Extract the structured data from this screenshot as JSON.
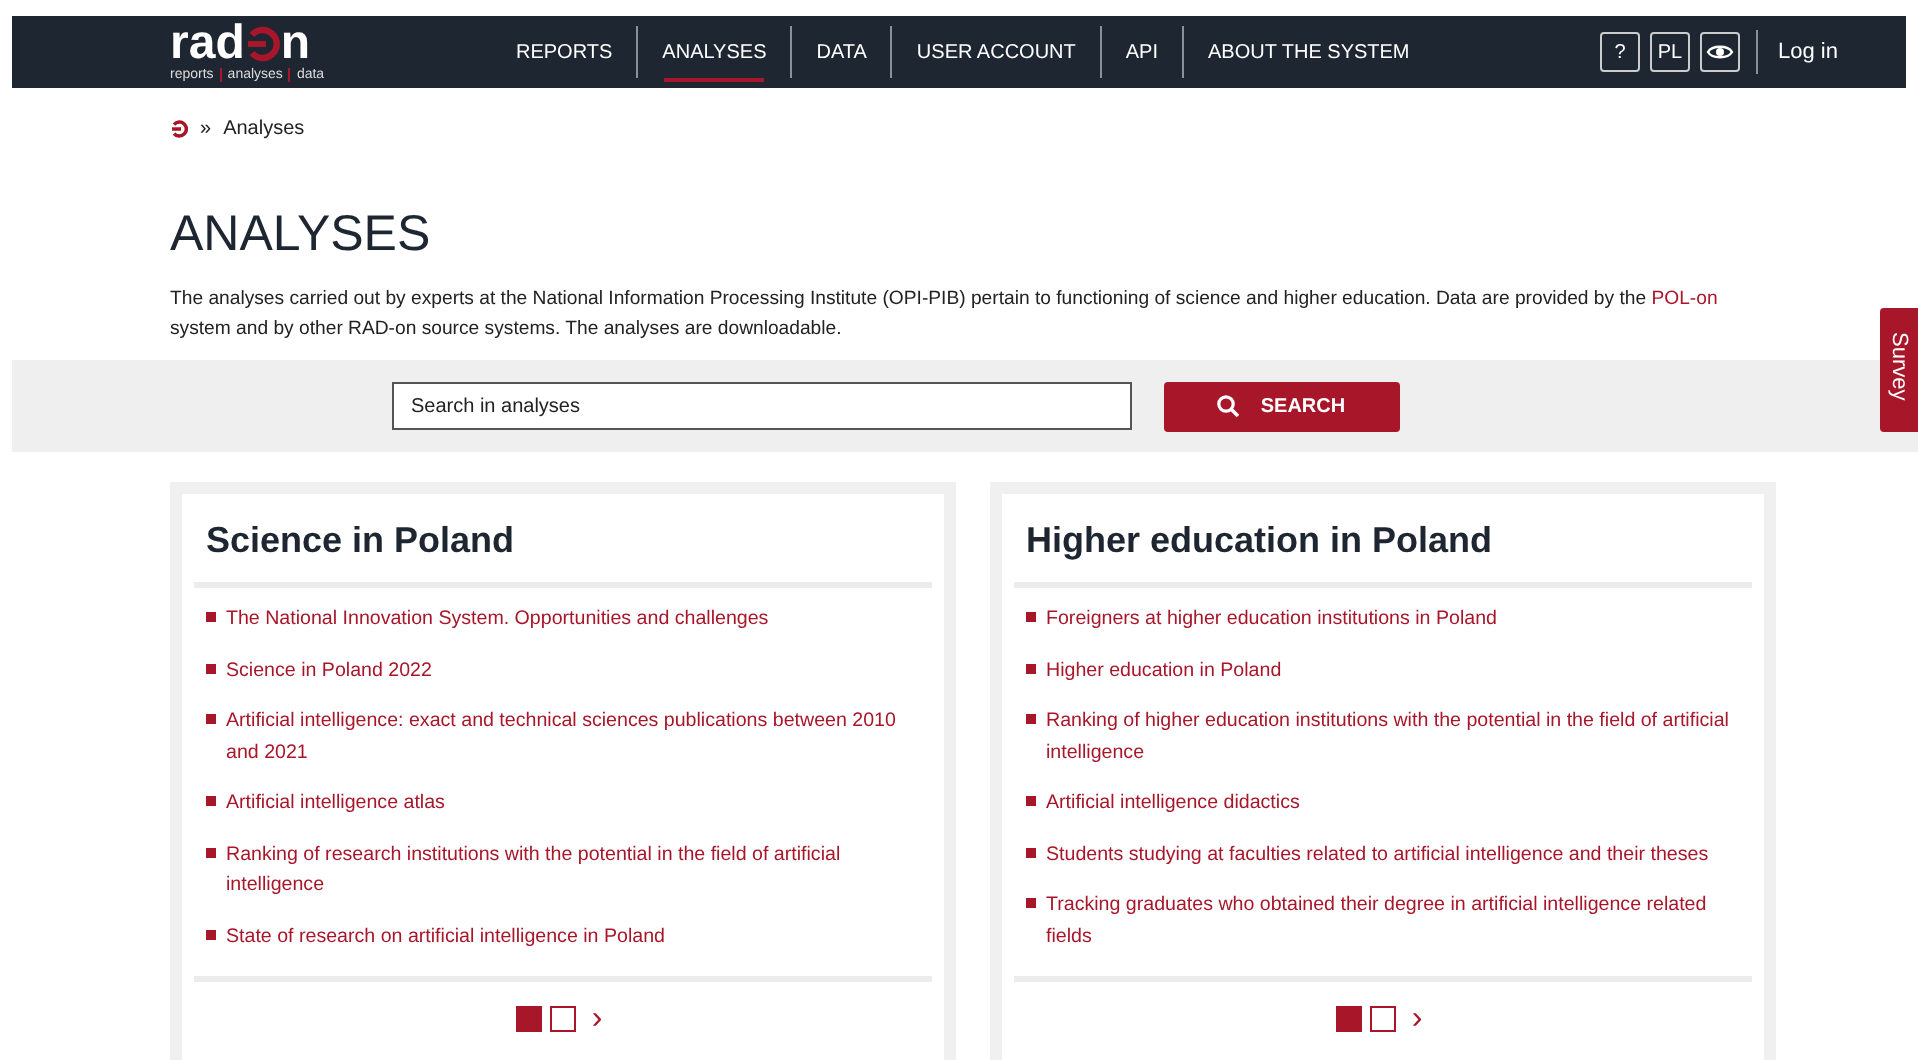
{
  "header": {
    "logo": {
      "start": "rad",
      "end": "n",
      "tagline": [
        "reports",
        "analyses",
        "data"
      ]
    },
    "nav": [
      {
        "label": "REPORTS",
        "selected": false
      },
      {
        "label": "ANALYSES",
        "selected": true
      },
      {
        "label": "DATA",
        "selected": false
      },
      {
        "label": "USER ACCOUNT",
        "selected": false
      },
      {
        "label": "API",
        "selected": false
      },
      {
        "label": "ABOUT THE SYSTEM",
        "selected": false
      }
    ],
    "tools": [
      {
        "kind": "text",
        "label": "?"
      },
      {
        "kind": "text",
        "label": "PL"
      },
      {
        "kind": "eye"
      }
    ],
    "login": "Log in"
  },
  "breadcrumb": {
    "separator": "»",
    "current": "Analyses"
  },
  "title": "ANALYSES",
  "description": {
    "text": "The analyses carried out by experts at the National Information Processing Institute (OPI-PIB) pertain to functioning of science and higher education. Data are provided by the ",
    "link": "POL-on",
    "rest": " system and by other RAD-on source systems. The analyses are downloadable."
  },
  "search": {
    "placeholder": "Search in analyses",
    "button": "SEARCH"
  },
  "survey_tab": "Survey",
  "cards": [
    {
      "title": "Science in Poland",
      "items": [
        "The National Innovation System. Opportunities and challenges",
        "Science in Poland 2022",
        "Artificial intelligence: exact and technical sciences publications between 2010 and 2021",
        "Artificial intelligence atlas",
        "Ranking of research institutions with the potential in the field of artificial intelligence",
        "State of research on artificial intelligence in Poland"
      ],
      "pages": [
        {
          "selected": true
        },
        {
          "selected": false
        }
      ],
      "next": "›"
    },
    {
      "title": "Higher education in Poland",
      "items": [
        "Foreigners at higher education institutions in Poland",
        "Higher education in Poland",
        "Ranking of higher education institutions with the potential in the field of artificial intelligence",
        "Artificial intelligence didactics",
        "Students studying at faculties related to artificial intelligence and their theses",
        "Tracking graduates who obtained their degree in artificial intelligence related fields"
      ],
      "pages": [
        {
          "selected": true
        },
        {
          "selected": false
        }
      ],
      "next": "›"
    }
  ]
}
